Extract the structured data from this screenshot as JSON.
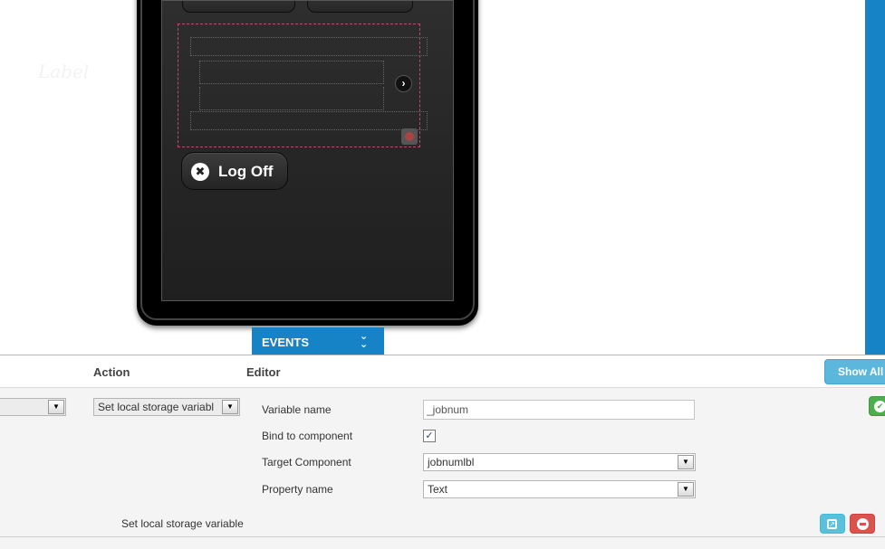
{
  "device_preview": {
    "list_item_label": "Label",
    "logoff_label": "Log Off"
  },
  "events_tab": {
    "label": "EVENTS"
  },
  "events_panel": {
    "headers": {
      "action": "Action",
      "editor": "Editor"
    },
    "show_all_label": "Show All",
    "event_row": {
      "event_select_value": "",
      "action_select_value": "Set local storage variabl"
    },
    "editor": {
      "variable_name_label": "Variable name",
      "variable_name_value": "_jobnum",
      "bind_label": "Bind to component",
      "bind_checked": true,
      "target_label": "Target Component",
      "target_value": "jobnumlbl",
      "property_label": "Property name",
      "property_value": "Text"
    },
    "summary_text": "Set local storage variable"
  },
  "colors": {
    "accent": "#1583c6",
    "show_all": "#5bb8dc",
    "success": "#4cae4c",
    "danger": "#d9534f",
    "info": "#5bc0de"
  }
}
